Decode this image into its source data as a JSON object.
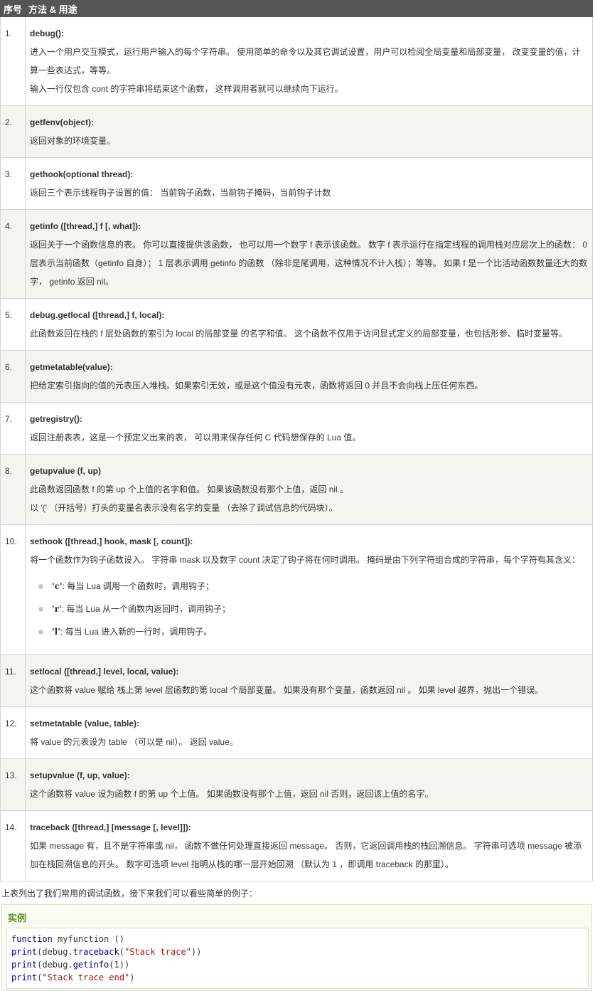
{
  "table": {
    "headers": [
      "序号",
      "方法 & 用途"
    ],
    "rows": [
      {
        "num": "1.",
        "method": "debug():",
        "lines": [
          "进入一个用户交互模式，运行用户输入的每个字符串。 使用简单的命令以及其它调试设置，用户可以检阅全局变量和局部变量， 改变变量的值，计算一些表达式，等等。",
          "输入一行仅包含 cont 的字符串将结束这个函数， 这样调用者就可以继续向下运行。"
        ]
      },
      {
        "num": "2.",
        "method": "getfenv(object):",
        "lines": [
          "返回对象的环境变量。"
        ]
      },
      {
        "num": "3.",
        "method": "gethook(optional thread):",
        "lines": [
          "返回三个表示线程钩子设置的值： 当前钩子函数，当前钩子掩码，当前钩子计数"
        ]
      },
      {
        "num": "4.",
        "method": "getinfo ([thread,] f [, what]):",
        "lines": [
          "返回关于一个函数信息的表。 你可以直接提供该函数， 也可以用一个数字 f 表示该函数。 数字 f 表示运行在指定线程的调用栈对应层次上的函数： 0 层表示当前函数（getinfo 自身）； 1 层表示调用 getinfo 的函数 （除非是尾调用，这种情况不计入栈）；等等。 如果 f 是一个比活动函数数量还大的数字， getinfo 返回 nil。"
        ]
      },
      {
        "num": "5.",
        "method": "debug.getlocal ([thread,] f, local):",
        "lines": [
          "此函数返回在栈的 f 层处函数的索引为 local 的局部变量 的名字和值。 这个函数不仅用于访问显式定义的局部变量，也包括形参、临时变量等。"
        ]
      },
      {
        "num": "6.",
        "method": "getmetatable(value):",
        "lines": [
          "把给定索引指向的值的元表压入堆栈。如果索引无效，或是这个值没有元表，函数将返回 0 并且不会向栈上压任何东西。"
        ]
      },
      {
        "num": "7.",
        "method": "getregistry():",
        "lines": [
          "返回注册表表，这是一个预定义出来的表， 可以用来保存任何 C 代码想保存的 Lua 值。"
        ]
      },
      {
        "num": "8.",
        "method": "getupvalue (f, up)",
        "lines": [
          "此函数返回函数 f 的第 up 个上值的名字和值。 如果该函数没有那个上值，返回 nil 。",
          "以 '(' （开括号）打头的变量名表示没有名字的变量 （去除了调试信息的代码块）。"
        ]
      },
      {
        "num": "10.",
        "method": "sethook ([thread,] hook, mask [, count]):",
        "lines": [
          "将一个函数作为钩子函数设入。 字符串 mask 以及数字 count 决定了钩子将在何时调用。 掩码是由下列字符组合成的字符串，每个字符有其含义："
        ],
        "options": [
          {
            "code": "'c'",
            "text": ": 每当 Lua 调用一个函数时，调用钩子；"
          },
          {
            "code": "'r'",
            "text": ": 每当 Lua 从一个函数内返回时，调用钩子；"
          },
          {
            "code": "'l'",
            "text": ": 每当 Lua 进入新的一行时，调用钩子。"
          }
        ]
      },
      {
        "num": "11.",
        "method": "setlocal ([thread,] level, local, value):",
        "lines": [
          "这个函数将 value 赋给 栈上第 level 层函数的第 local 个局部变量。 如果没有那个变量，函数返回 nil 。 如果 level 越界，抛出一个错误。"
        ]
      },
      {
        "num": "12.",
        "method": "setmetatable (value, table):",
        "lines": [
          "将 value 的元表设为 table （可以是 nil）。 返回 value。"
        ]
      },
      {
        "num": "13.",
        "method": "setupvalue (f, up, value):",
        "lines": [
          "这个函数将 value 设为函数 f 的第 up 个上值。 如果函数没有那个上值，返回 nil 否则，返回该上值的名字。"
        ]
      },
      {
        "num": "14.",
        "method": "traceback ([thread,] [message [, level]]):",
        "lines": [
          "如果 message 有，且不是字符串或 nil， 函数不做任何处理直接返回 message。 否则，它返回调用栈的栈回溯信息。 字符串可选项 message 被添加在栈回溯信息的开头。 数字可选项 level 指明从栈的哪一层开始回溯 （默认为 1 ，即调用 traceback 的那里）。"
        ]
      }
    ]
  },
  "intro_text": "上表列出了我们常用的调试函数，接下来我们可以看些简单的例子：",
  "example": {
    "title": "实例",
    "code_lines": [
      [
        {
          "t": "function",
          "c": "kw"
        },
        {
          "t": " myfunction ()",
          "c": ""
        }
      ],
      [
        {
          "t": "print",
          "c": "fn"
        },
        {
          "t": "(debug.",
          "c": ""
        },
        {
          "t": "traceback",
          "c": "fn"
        },
        {
          "t": "(",
          "c": ""
        },
        {
          "t": "\"Stack trace\"",
          "c": "str"
        },
        {
          "t": "))",
          "c": ""
        }
      ],
      [
        {
          "t": "print",
          "c": "fn"
        },
        {
          "t": "(debug.",
          "c": ""
        },
        {
          "t": "getinfo",
          "c": "fn"
        },
        {
          "t": "(1))",
          "c": ""
        }
      ],
      [
        {
          "t": "print",
          "c": "fn"
        },
        {
          "t": "(",
          "c": ""
        },
        {
          "t": "\"Stack trace end\"",
          "c": "str"
        },
        {
          "t": ")",
          "c": ""
        }
      ]
    ]
  }
}
